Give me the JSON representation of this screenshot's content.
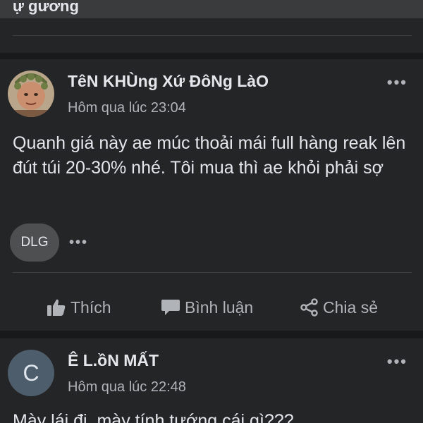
{
  "top_card": {
    "cut_text": "ự gương"
  },
  "posts": [
    {
      "author": "TêN KHÙng Xứ ĐôNg LàO",
      "timestamp": "Hôm qua lúc 23:04",
      "text": "Quanh giá này ae múc thoải mái full hàng reak lên đút túi 20-30% nhé. Tôi mua thì ae khỏi phải sợ",
      "tag": "DLG",
      "more_label": "•••"
    },
    {
      "author": "Ê L.ồN MẤT",
      "avatar_letter": "C",
      "timestamp": "Hôm qua lúc 22:48",
      "text": "Mày lái đi, mày tính tướng cái gì???",
      "more_label": "•••"
    }
  ],
  "actions": {
    "like": "Thích",
    "comment": "Bình luận",
    "share": "Chia sẻ"
  },
  "icons": {
    "like": "thumbs-up-icon",
    "comment": "comment-bubble-icon",
    "share": "share-icon",
    "more": "ellipsis-icon"
  },
  "colors": {
    "background": "#18191a",
    "card": "#242526",
    "text_primary": "#e4e6eb",
    "text_secondary": "#b0b3b8",
    "pill": "#4e4f50"
  }
}
